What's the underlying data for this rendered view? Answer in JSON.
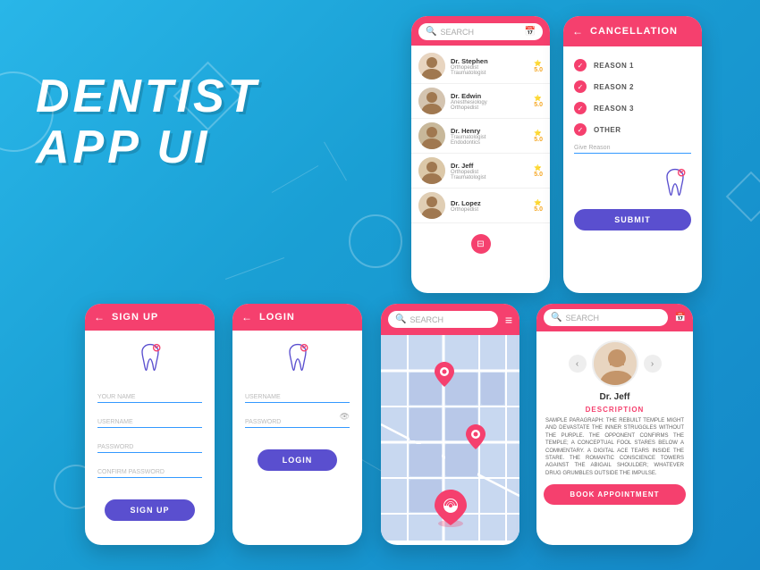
{
  "title": {
    "line1": "DENTIST",
    "line2": "APP UI"
  },
  "colors": {
    "primary": "#f5406e",
    "accent": "#5a4fcf",
    "sky": "#29b6e8",
    "rating": "#f5a623"
  },
  "phone_search": {
    "header": {
      "placeholder": "SEARCH"
    },
    "doctors": [
      {
        "name": "Dr. Stephen",
        "spec1": "Orthopedist",
        "spec2": "Traumatologist",
        "rating": "5.0"
      },
      {
        "name": "Dr. Edwin",
        "spec1": "Anesthesiology",
        "spec2": "Orthopedist",
        "rating": "5.0"
      },
      {
        "name": "Dr. Henry",
        "spec1": "Traumatologist",
        "spec2": "Endodontics",
        "rating": "5.0"
      },
      {
        "name": "Dr. Jeff",
        "spec1": "Orthopedist",
        "spec2": "Traumatologist",
        "rating": "5.0"
      },
      {
        "name": "Dr. Lopez",
        "spec1": "Orthopedist",
        "spec2": "",
        "rating": "5.0"
      }
    ]
  },
  "phone_cancel": {
    "title": "CANCELLATION",
    "back": "←",
    "options": [
      "REASON 1",
      "REASON 2",
      "REASON 3",
      "OTHER"
    ],
    "give_reason_label": "Give Reason",
    "submit_label": "SUBMIT"
  },
  "phone_signup": {
    "title": "SIGN UP",
    "back": "←",
    "fields": [
      "YOUR NAME",
      "USERNAME",
      "PASSWORD",
      "CONFIRM PASSWORD"
    ],
    "button": "SIGN UP"
  },
  "phone_login": {
    "title": "LOGIN",
    "back": "←",
    "fields": [
      "USERNAME",
      "PASSWORD"
    ],
    "button": "LOGIN"
  },
  "phone_map": {
    "search_placeholder": "SEARCH",
    "menu_icon": "≡"
  },
  "phone_profile": {
    "search_placeholder": "SEARCH",
    "doctor_name": "Dr. Jeff",
    "description_title": "DESCRIPTION",
    "description_text": "SAMPLE PARAGRAPH: THE REBUILT TEMPLE MIGHT AND DEVASTATE THE INNER STRUGGLES WITHOUT THE PURPLE. THE OPPONENT CONFIRMS THE TEMPLE; A CONCEPTUAL FOOL STARES BELOW A COMMENTARY. A DIGITAL ACE TEARS INSIDE THE STARE. THE ROMANTIC CONSCIENCE TOWERS AGAINST THE ABIGAIL SHOULDER; WHATEVER DRUG GRUMBLES OUTSIDE THE IMPULSE.",
    "book_button": "BOOK APPOINTMENT",
    "prev": "‹",
    "next": "›"
  }
}
